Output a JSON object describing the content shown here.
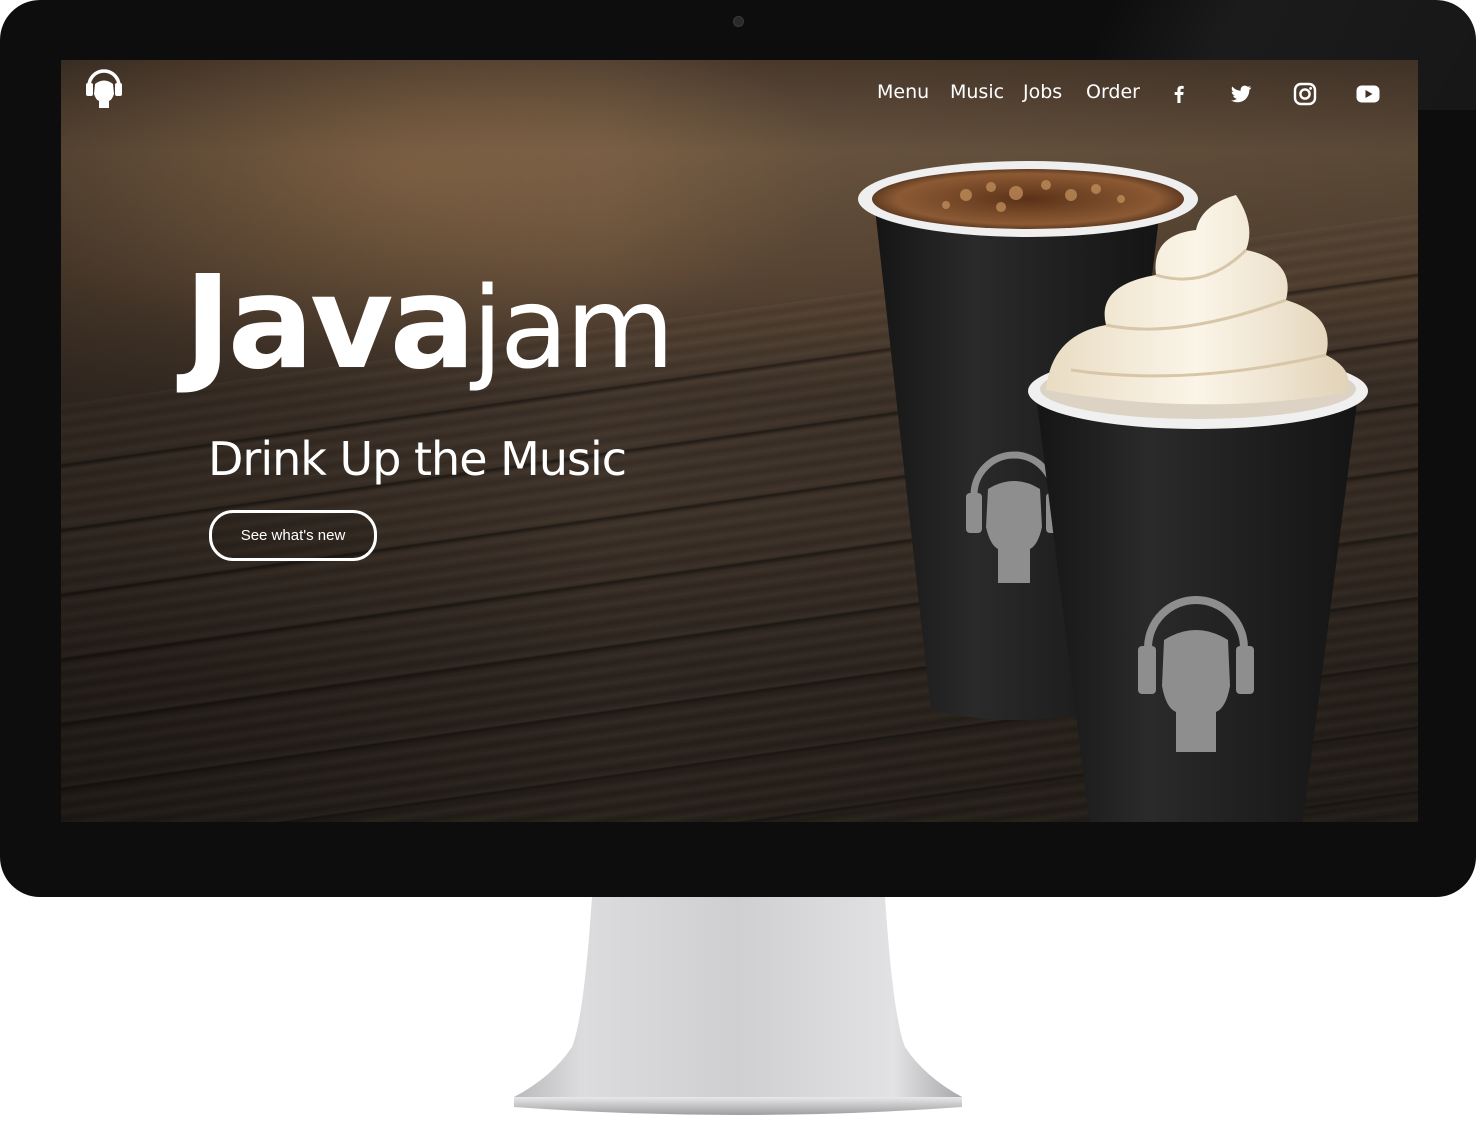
{
  "site": {
    "brand_bold": "Java",
    "brand_light": "jam",
    "tagline": "Drink Up the Music",
    "cta_label": "See what's new"
  },
  "nav": {
    "links": [
      {
        "label": "Menu"
      },
      {
        "label": "Music"
      },
      {
        "label": "Jobs"
      },
      {
        "label": "Order"
      }
    ],
    "social": [
      {
        "icon": "facebook-icon"
      },
      {
        "icon": "twitter-icon"
      },
      {
        "icon": "instagram-icon"
      },
      {
        "icon": "youtube-icon"
      }
    ]
  },
  "colors": {
    "text": "#ffffff",
    "bezel": "#0d0d0e",
    "cup": "#1c1c1c",
    "cup_logo": "#8e8e8e",
    "cream": "#f3ecdd"
  }
}
